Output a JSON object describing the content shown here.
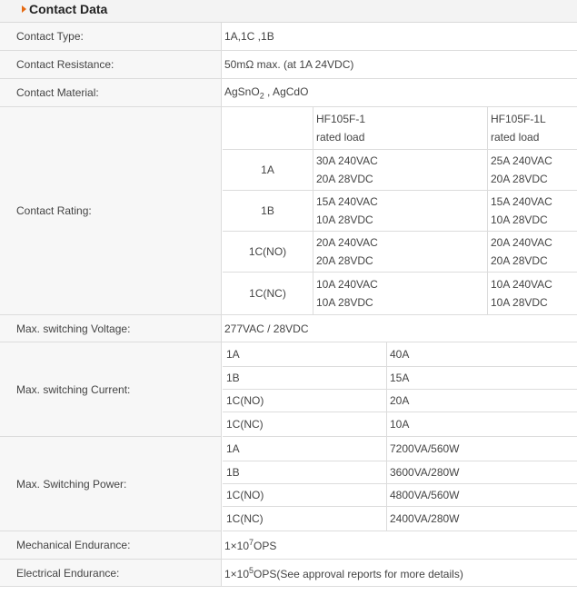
{
  "header": {
    "title": "Contact Data"
  },
  "rows": {
    "contact_type": {
      "label": "Contact Type:",
      "value": "1A,1C ,1B"
    },
    "contact_resistance": {
      "label": "Contact Resistance:",
      "value": "50mΩ max. (at 1A 24VDC)"
    },
    "contact_material": {
      "label": "Contact Material:",
      "value_a": "AgSnO",
      "value_sub": "2",
      "value_b": " , AgCdO"
    },
    "contact_rating": {
      "label": "Contact Rating:",
      "col1_header": [
        "HF105F-1",
        "rated load"
      ],
      "col2_header": [
        "HF105F-1L",
        "rated load"
      ],
      "rows": [
        {
          "type": "1A",
          "col1": [
            "30A 240VAC",
            "20A 28VDC"
          ],
          "col2": [
            "25A 240VAC",
            "20A 28VDC"
          ]
        },
        {
          "type": "1B",
          "col1": [
            "15A 240VAC",
            "10A 28VDC"
          ],
          "col2": [
            "15A 240VAC",
            "10A 28VDC"
          ]
        },
        {
          "type": "1C(NO)",
          "col1": [
            "20A 240VAC",
            "20A 28VDC"
          ],
          "col2": [
            "20A 240VAC",
            "20A 28VDC"
          ]
        },
        {
          "type": "1C(NC)",
          "col1": [
            "10A 240VAC",
            "10A 28VDC"
          ],
          "col2": [
            "10A 240VAC",
            "10A 28VDC"
          ]
        }
      ]
    },
    "max_voltage": {
      "label": "Max. switching Voltage:",
      "value": "277VAC / 28VDC"
    },
    "max_current": {
      "label": "Max. switching Current:",
      "items": [
        {
          "type": "1A",
          "value": "40A"
        },
        {
          "type": "1B",
          "value": "15A"
        },
        {
          "type": "1C(NO)",
          "value": "20A"
        },
        {
          "type": "1C(NC)",
          "value": "10A"
        }
      ]
    },
    "max_power": {
      "label": "Max. Switching Power:",
      "items": [
        {
          "type": "1A",
          "value": "7200VA/560W"
        },
        {
          "type": "1B",
          "value": "3600VA/280W"
        },
        {
          "type": "1C(NO)",
          "value": "4800VA/560W"
        },
        {
          "type": "1C(NC)",
          "value": "2400VA/280W"
        }
      ]
    },
    "mechanical_endurance": {
      "label": "Mechanical Endurance:",
      "value_a": "1×10",
      "value_exp": "7",
      "value_b": "OPS"
    },
    "electrical_endurance": {
      "label": "Electrical Endurance:",
      "value_a": "1×10",
      "value_exp": "5",
      "value_b": "OPS(See approval reports for more details)"
    }
  },
  "colors": {
    "accent": "#e56a12",
    "label_bg": "#f7f7f7",
    "border": "#dcdcdc"
  }
}
